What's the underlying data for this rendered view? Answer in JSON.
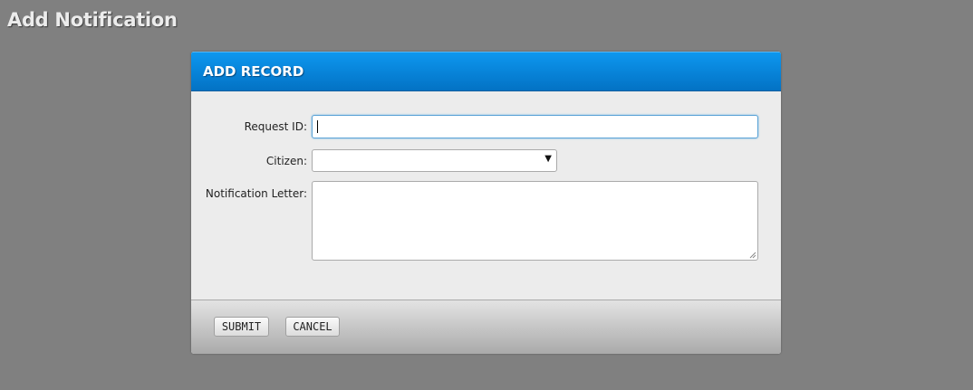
{
  "page": {
    "title": "Add Notification"
  },
  "dialog": {
    "title": "ADD RECORD",
    "header_color": "#0a86dc",
    "fields": {
      "request_id": {
        "label": "Request ID:",
        "value": ""
      },
      "citizen": {
        "label": "Citizen:",
        "selected": "",
        "arrow_icon": "triangle-down-icon"
      },
      "notification_letter": {
        "label": "Notification Letter:",
        "value": ""
      }
    },
    "buttons": {
      "submit": "SUBMIT",
      "cancel": "CANCEL"
    }
  }
}
